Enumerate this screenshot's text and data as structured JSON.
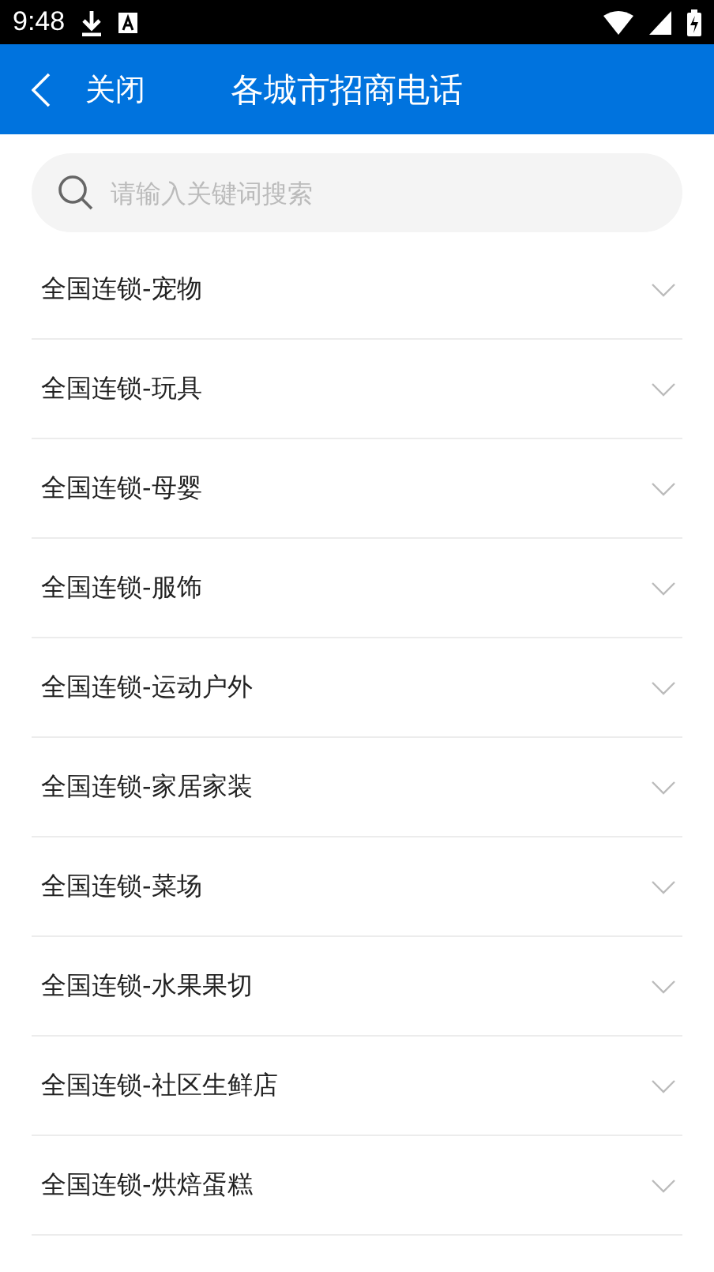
{
  "status_bar": {
    "time": "9:48"
  },
  "header": {
    "back_label": "关闭",
    "title": "各城市招商电话"
  },
  "search": {
    "placeholder": "请输入关键词搜索"
  },
  "items": [
    {
      "label": "全国连锁-宠物"
    },
    {
      "label": "全国连锁-玩具"
    },
    {
      "label": "全国连锁-母婴"
    },
    {
      "label": "全国连锁-服饰"
    },
    {
      "label": "全国连锁-运动户外"
    },
    {
      "label": "全国连锁-家居家装"
    },
    {
      "label": "全国连锁-菜场"
    },
    {
      "label": "全国连锁-水果果切"
    },
    {
      "label": "全国连锁-社区生鲜店"
    },
    {
      "label": "全国连锁-烘焙蛋糕"
    }
  ]
}
